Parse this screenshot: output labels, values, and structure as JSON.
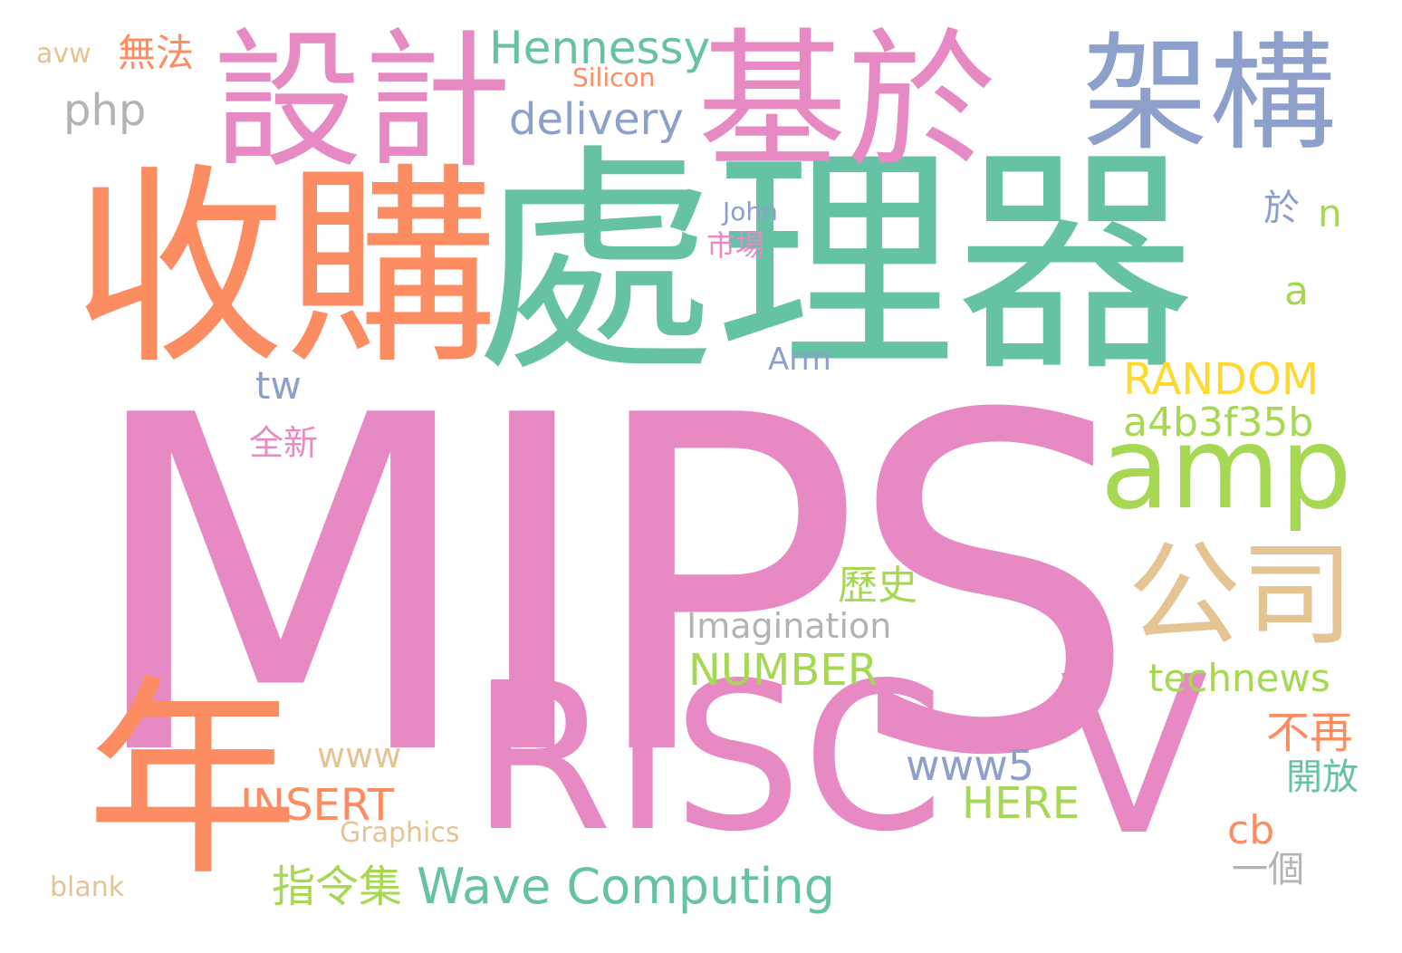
{
  "colors": {
    "pink": "#e78ac3",
    "green": "#66c2a5",
    "orange": "#fc8d62",
    "blue": "#8da0cb",
    "lime": "#a6d854",
    "yellow": "#ffd92f",
    "tan": "#e5c494",
    "gray": "#b3b3b3"
  },
  "words": [
    "MIPS",
    "處理器",
    "收購",
    "RISC",
    "V",
    "年",
    "基於",
    "設計",
    "架構",
    "公司",
    "amp",
    "Hennessy",
    "delivery",
    "php",
    "無法",
    "avw",
    "Silicon",
    "RANDOM",
    "a4b3f35b",
    "technews",
    "NUMBER",
    "Imagination",
    "Wave Computing",
    "指令集",
    "INSERT",
    "HERE",
    "www5",
    "www",
    "cb",
    "不再",
    "開放",
    "一個",
    "Graphics",
    "blank",
    "歷史",
    "全新",
    "tw",
    "Arm",
    "市場",
    "John",
    "於",
    "n",
    "a"
  ]
}
